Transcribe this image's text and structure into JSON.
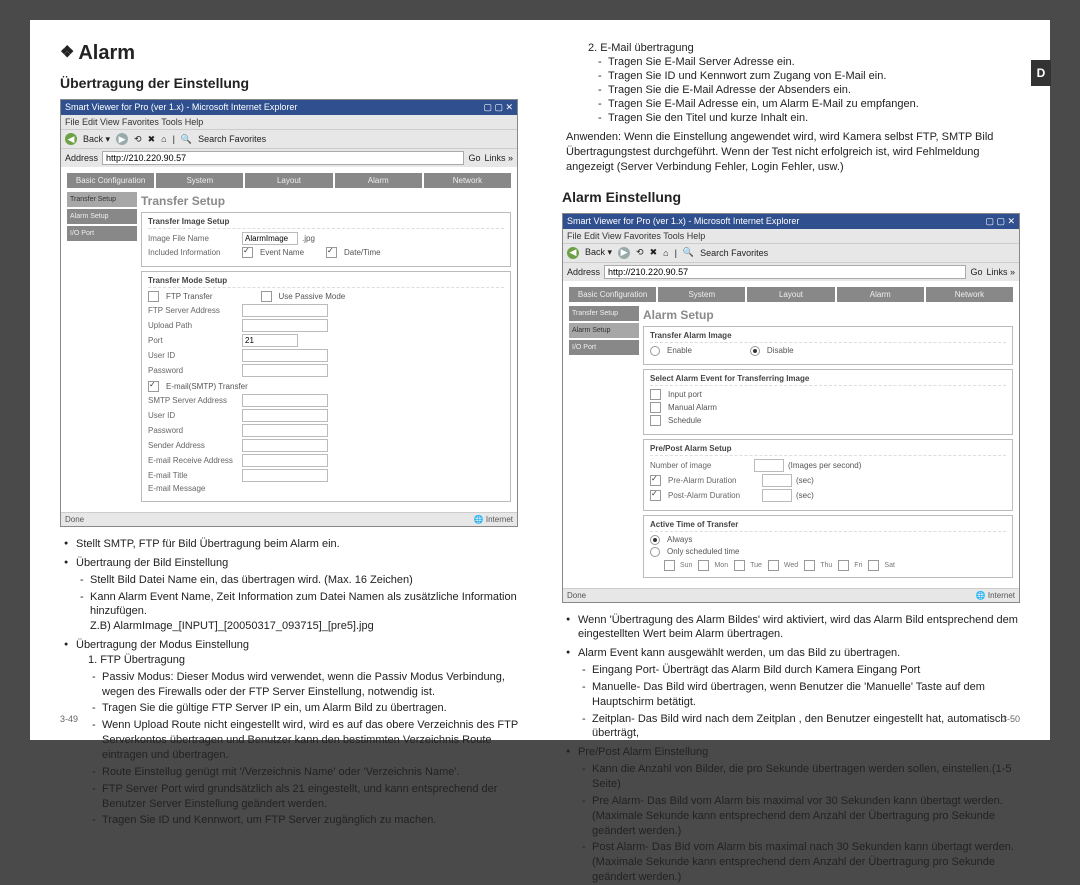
{
  "pageLeftNum": "3-49",
  "pageRightNum": "3-50",
  "sideTab": "D",
  "left": {
    "h1": "Alarm",
    "h2": "Übertragung der Einstellung",
    "browser": {
      "title": "Smart Viewer for Pro (ver 1.x) - Microsoft Internet Explorer",
      "menuLine": "File   Edit   View   Favorites   Tools   Help",
      "toolbarText": "Search   Favorites",
      "addr": "http://210.220.90.57",
      "goBtn": "Go",
      "tabs": [
        "Basic Configuration",
        "System",
        "Layout",
        "Alarm",
        "Network"
      ],
      "sidebar": [
        "Transfer Setup",
        "Alarm Setup",
        "I/O Port"
      ],
      "contentTitle": "Transfer Setup",
      "p1": {
        "title": "Transfer Image Setup",
        "imgFileLbl": "Image File Name",
        "imgFileVal": "AlarmImage",
        "ext": ".jpg",
        "incLbl": "Included Information",
        "cbEvent": "Event Name",
        "cbDate": "Date/Time"
      },
      "p2": {
        "title": "Transfer Mode Setup",
        "cbFtp": "FTP Transfer",
        "cbPassive": "Use Passive Mode",
        "r1": "FTP Server Address",
        "r2": "Upload Path",
        "r3": "Port",
        "r3v": "21",
        "r4": "User ID",
        "r5": "Password",
        "cbSmtp": "E-mail(SMTP) Transfer",
        "s1": "SMTP Server Address",
        "s2": "User ID",
        "s3": "Password",
        "s4": "Sender Address",
        "s5": "E-mail Receive Address",
        "s6": "E-mail Title",
        "s7": "E-mail Message"
      },
      "statusLeft": "Done",
      "statusRight": "Internet"
    },
    "bullets": {
      "b1": "Stellt SMTP, FTP für Bild Übertragung beim Alarm ein.",
      "b2": "Übertraung der Bild Einstellung",
      "b2s1": "Stellt Bild Datei Name ein, das übertragen wird. (Max. 16 Zeichen)",
      "b2s2": "Kann Alarm Event Name, Zeit Information zum Datei Namen als zusätzliche Information hinzufügen.",
      "b2s2ex": "Z.B)  AlarmImage_[INPUT]_[20050317_093715]_[pre5].jpg",
      "b3": "Übertragung der Modus Einstellung",
      "b3n1": "1. FTP Übertragung",
      "b3n1s1": "Passiv Modus: Dieser Modus wird verwendet, wenn die Passiv Modus Verbindung, wegen des Firewalls oder der FTP Server Einstellung, notwendig ist.",
      "b3n1s2": "Tragen Sie die gültige FTP Server IP ein, um Alarm Bild zu übertragen.",
      "b3n1s3": "Wenn Upload Route nicht eingestellt wird, wird es auf das obere Verzeichnis des FTP Serverkontos übertragen und Benutzer kann den bestimmten Verzeichnis Route eintragen und übertragen.",
      "b3n1s4": "Route Einstellug genügt mit '/Verzeichnis Name' oder 'Verzeichnis Name'.",
      "b3n1s5": "FTP Server Port wird grundsätzlich als 21 eingestellt, und kann entsprechend der Benutzer Server Einstellung geändert werden.",
      "b3n1s6": "Tragen Sie ID und Kennwort, um FTP Server zugänglich zu machen."
    }
  },
  "right": {
    "topNum": "2. E-Mail übertragung",
    "topS1": "Tragen Sie E-Mail Server Adresse ein.",
    "topS2": "Tragen Sie ID und Kennwort zum Zugang von E-Mail ein.",
    "topS3": "Tragen Sie die E-Mail Adresse der Absenders ein.",
    "topS4": "Tragen Sie E-Mail Adresse ein, um Alarm E-Mail zu empfangen.",
    "topS5": "Tragen Sie den Titel und kurze Inhalt ein.",
    "apply": "Anwenden: Wenn die Einstellung angewendet wird, wird Kamera selbst FTP, SMTP Bild Übertragungstest durchgeführt. Wenn der Test nicht erfolgreich ist, wird Fehlmeldung angezeigt (Server Verbindung Fehler, Login Fehler, usw.)",
    "h2": "Alarm Einstellung",
    "browser": {
      "title": "Smart Viewer for Pro (ver 1.x) - Microsoft Internet Explorer",
      "menuLine": "File   Edit   View   Favorites   Tools   Help",
      "toolbarText": "Search   Favorites",
      "addr": "http://210.220.90.57",
      "goBtn": "Go",
      "tabs": [
        "Basic Configuration",
        "System",
        "Layout",
        "Alarm",
        "Network"
      ],
      "sidebar": [
        "Transfer Setup",
        "Alarm Setup",
        "I/O Port"
      ],
      "contentTitle": "Alarm Setup",
      "p1": {
        "title": "Transfer Alarm Image",
        "en": "Enable",
        "dis": "Disable"
      },
      "p2": {
        "title": "Select Alarm Event for Transferring Image",
        "r1": "Input port",
        "r2": "Manual Alarm",
        "r3": "Schedule"
      },
      "p3": {
        "title": "Pre/Post Alarm Setup",
        "r1": "Number of image",
        "r1u": "(Images per second)",
        "r2": "Pre-Alarm Duration",
        "r3": "Post-Alarm Duration",
        "unit": "(sec)"
      },
      "p4": {
        "title": "Active Time of Transfer",
        "o1": "Always",
        "o2": "Only scheduled time",
        "days": [
          "Sun",
          "Mon",
          "Tue",
          "Wed",
          "Thu",
          "Fri",
          "Sat"
        ]
      },
      "statusLeft": "Done",
      "statusRight": "Internet"
    },
    "bullets": {
      "b1": "Wenn 'Übertragung des Alarm Bildes' wird aktiviert, wird das Alarm Bild entsprechend dem eingestellten Wert beim Alarm übertragen.",
      "b2": "Alarm Event kann ausgewählt werden, um das Bild zu übertragen.",
      "b2s1": "Eingang Port- Überträgt das Alarm Bild durch Kamera Eingang Port",
      "b2s2": "Manuelle- Das Bild wird übertragen, wenn Benutzer die 'Manuelle' Taste auf dem Hauptschirm betätigt.",
      "b2s3": "Zeitplan- Das Bild wird nach dem Zeitplan , den Benutzer eingestellt hat, automatisch überträgt,",
      "b3": "Pre/Post Alarm Einstellung",
      "b3s1": "Kann die Anzahl von Bilder, die pro Sekunde übertragen werden sollen, einstellen.(1-5 Seite)",
      "b3s2": "Pre Alarm- Das Bild vom Alarm bis maximal vor 30 Sekunden kann übertagt werden. (Maximale Sekunde kann entsprechend dem Anzahl der Übertragung pro Sekunde geändert werden.)",
      "b3s3": "Post Alarm- Das Bid vom Alarm bis maximal nach 30 Sekunden kann übertagt werden. (Maximale Sekunde kann entsprechend dem Anzahl der Übertragung pro Sekunde geändert werden.)"
    }
  }
}
